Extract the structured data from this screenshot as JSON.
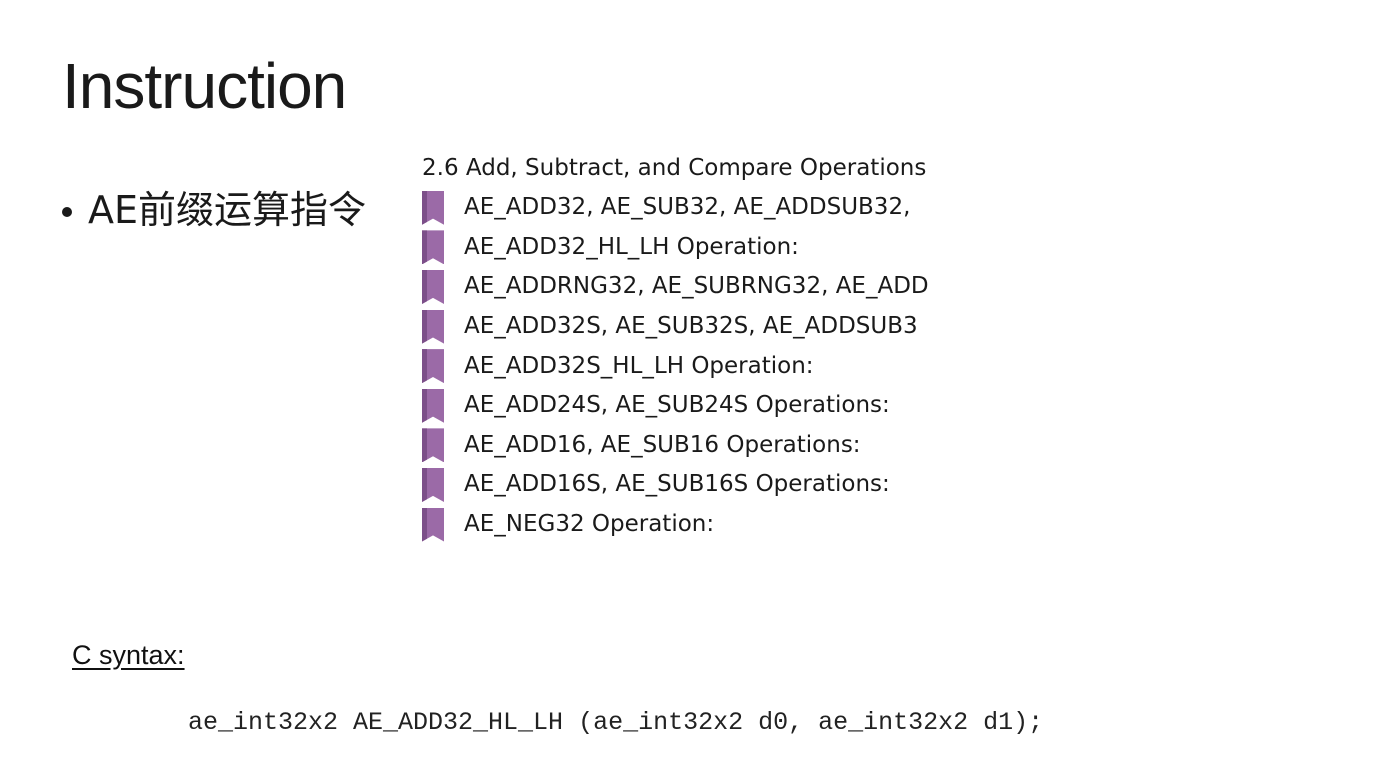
{
  "slide": {
    "title": "Instruction",
    "bullet": "AE前缀运算指令"
  },
  "bookmarks": {
    "heading": "2.6 Add, Subtract, and Compare Operations",
    "icon": "bookmark-icon",
    "icon_color": "#9b6aa7",
    "items": [
      {
        "label": "AE_ADD32, AE_SUB32, AE_ADDSUB32,"
      },
      {
        "label": "AE_ADD32_HL_LH Operation:"
      },
      {
        "label": "AE_ADDRNG32, AE_SUBRNG32, AE_ADD"
      },
      {
        "label": "AE_ADD32S, AE_SUB32S, AE_ADDSUB3"
      },
      {
        "label": "AE_ADD32S_HL_LH Operation:"
      },
      {
        "label": "AE_ADD24S, AE_SUB24S Operations:"
      },
      {
        "label": "AE_ADD16, AE_SUB16 Operations:"
      },
      {
        "label": "AE_ADD16S, AE_SUB16S Operations:"
      },
      {
        "label": "AE_NEG32 Operation:"
      }
    ]
  },
  "syntax": {
    "heading": "C syntax:",
    "code": "ae_int32x2 AE_ADD32_HL_LH (ae_int32x2 d0, ae_int32x2 d1);"
  }
}
